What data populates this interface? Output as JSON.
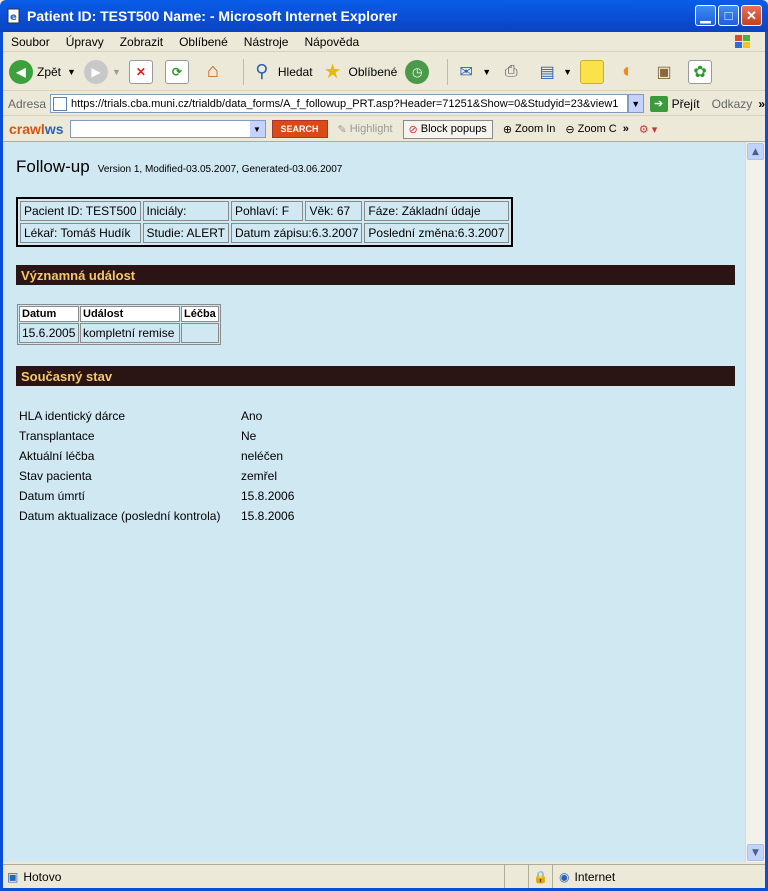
{
  "window": {
    "title": "Patient ID: TEST500 Name: - Microsoft Internet Explorer",
    "menu": [
      "Soubor",
      "Úpravy",
      "Zobrazit",
      "Oblíbené",
      "Nástroje",
      "Nápověda"
    ],
    "toolbar": {
      "back": "Zpět",
      "search": "Hledat",
      "favorites": "Oblíbené"
    },
    "address": {
      "label": "Adresa",
      "url": "https://trials.cba.muni.cz/trialdb/data_forms/A_f_followup_PRT.asp?Header=71251&Show=0&Studyid=23&view1",
      "go": "Přejít",
      "links": "Odkazy"
    },
    "crawler": {
      "logo_a": "crawl",
      "logo_b": "ws",
      "search_button": "SEARCH",
      "highlight": "Highlight",
      "block_popups": "Block popups",
      "zoom_in": "Zoom In",
      "zoom_out": "Zoom C"
    },
    "status": {
      "left": "Hotovo",
      "zone": "Internet"
    }
  },
  "page": {
    "title": "Follow-up",
    "subtitle": "Version 1, Modified-03.05.2007, Generated-03.06.2007",
    "info": {
      "row1": [
        "Pacient ID: TEST500",
        "Iniciály:",
        "Pohlaví: F",
        "Věk: 67",
        "Fáze: Základní údaje"
      ],
      "row2": [
        "Lékař: Tomáš Hudík",
        "Studie: ALERT",
        "Datum zápisu:6.3.2007",
        "Poslední změna:6.3.2007"
      ]
    },
    "section_event": "Významná událost",
    "event_table": {
      "headers": [
        "Datum",
        "Událost",
        "Léčba"
      ],
      "rows": [
        [
          "15.6.2005",
          "kompletní remise",
          ""
        ]
      ]
    },
    "section_state": "Současný stav",
    "state": [
      {
        "label": "HLA identický dárce",
        "value": "Ano"
      },
      {
        "label": "Transplantace",
        "value": "Ne"
      },
      {
        "label": "Aktuální léčba",
        "value": "neléčen"
      },
      {
        "label": "Stav pacienta",
        "value": "zemřel"
      },
      {
        "label": "Datum úmrtí",
        "value": "15.8.2006"
      },
      {
        "label": "Datum aktualizace (poslední kontrola)",
        "value": "15.8.2006"
      }
    ]
  }
}
